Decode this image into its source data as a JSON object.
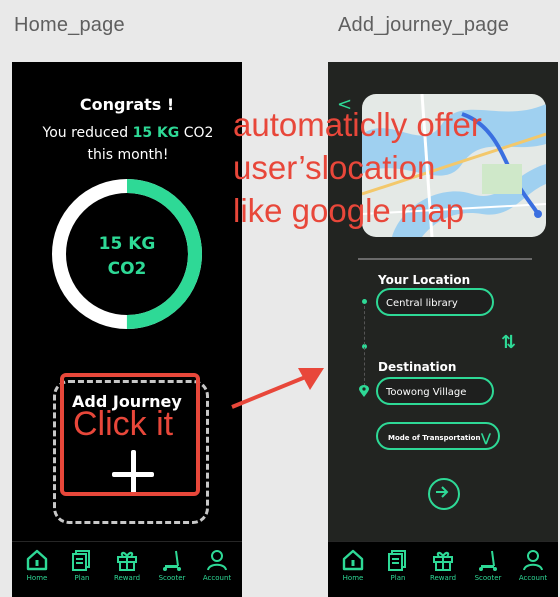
{
  "frames": {
    "home_title": "Home_page",
    "journey_title": "Add_journey_page"
  },
  "home": {
    "congrats_title": "Congrats !",
    "line1_prefix": "You reduced",
    "line1_highlight": "15 KG",
    "line1_suffix": "CO2",
    "line2": "this month!",
    "ring_value": "15 KG",
    "ring_unit": "CO2",
    "ring_progress_fraction": 0.5,
    "add_label": "Add Journey"
  },
  "annotations": {
    "click_it": "Click it",
    "location_note_line1": "automaticlly offer",
    "location_note_line2": "user’slocation",
    "location_note_line3": "like google map"
  },
  "journey": {
    "back_icon": "chevron-left-icon",
    "your_location_label": "Your Location",
    "your_location_value": "Central library",
    "destination_label": "Destination",
    "destination_value": "Toowong Village",
    "mode_label": "Mode of Transportation",
    "mode_arrow": "⋁",
    "swap_icon": "swap-vertical-icon",
    "go_icon": "arrow-circle-right-icon"
  },
  "tabs": [
    {
      "label": "Home",
      "icon": "home-icon"
    },
    {
      "label": "Plan",
      "icon": "plan-icon"
    },
    {
      "label": "Reward",
      "icon": "gift-icon"
    },
    {
      "label": "Scooter",
      "icon": "scooter-icon"
    },
    {
      "label": "Account",
      "icon": "account-icon"
    }
  ],
  "colors": {
    "accent": "#2ed996",
    "annotation": "#e8473a",
    "screen_bg": "#000000"
  }
}
